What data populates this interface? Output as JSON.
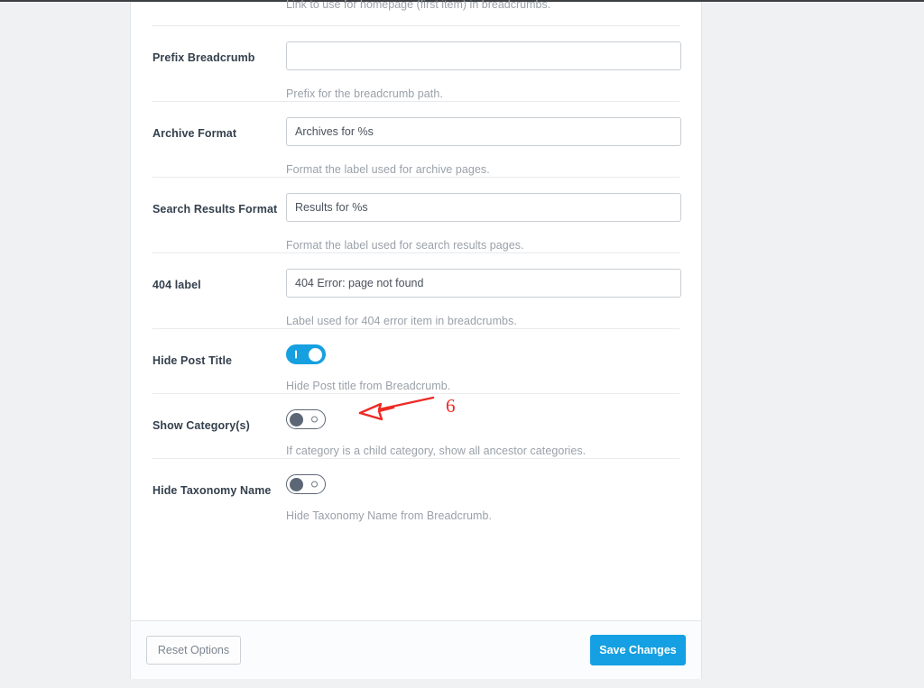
{
  "theme": {
    "accent_blue": "#14a0e2",
    "page_background": "#eff1f3",
    "card_background": "#ffffff",
    "label_color": "#34404d",
    "help_color": "#9aa1a9",
    "annotation_red": "#ee2a24",
    "toggle_off_color": "#5c6776"
  },
  "top_help": "Link to use for homepage (first item) in breadcrumbs.",
  "rows": [
    {
      "id": "prefix-breadcrumb",
      "label": "Prefix Breadcrumb",
      "control": "text",
      "value": "",
      "placeholder": "",
      "help": "Prefix for the breadcrumb path."
    },
    {
      "id": "archive-format",
      "label": "Archive Format",
      "control": "text",
      "value": "Archives for %s",
      "placeholder": "",
      "help": "Format the label used for archive pages."
    },
    {
      "id": "search-results-format",
      "label": "Search Results Format",
      "control": "text",
      "value": "Results for %s",
      "placeholder": "",
      "help": "Format the label used for search results pages."
    },
    {
      "id": "404-label",
      "label": "404 label",
      "control": "text",
      "value": "404 Error: page not found",
      "placeholder": "",
      "help": "Label used for 404 error item in breadcrumbs."
    },
    {
      "id": "hide-post-title",
      "label": "Hide Post Title",
      "control": "toggle",
      "state": "on",
      "state_label": "On",
      "help": "Hide Post title from Breadcrumb."
    },
    {
      "id": "show-categories",
      "label": "Show Category(s)",
      "control": "toggle",
      "state": "off",
      "state_label": "Off",
      "help": "If category is a child category, show all ancestor categories."
    },
    {
      "id": "hide-taxonomy-name",
      "label": "Hide Taxonomy Name",
      "control": "toggle",
      "state": "off",
      "state_label": "Off",
      "help": "Hide Taxonomy Name from Breadcrumb."
    }
  ],
  "footer": {
    "reset_label": "Reset Options",
    "save_label": "Save Changes"
  },
  "annotation": {
    "number": "6",
    "arrow_icon": "left-arrow-annotation-icon",
    "points_to": "hide-post-title"
  }
}
